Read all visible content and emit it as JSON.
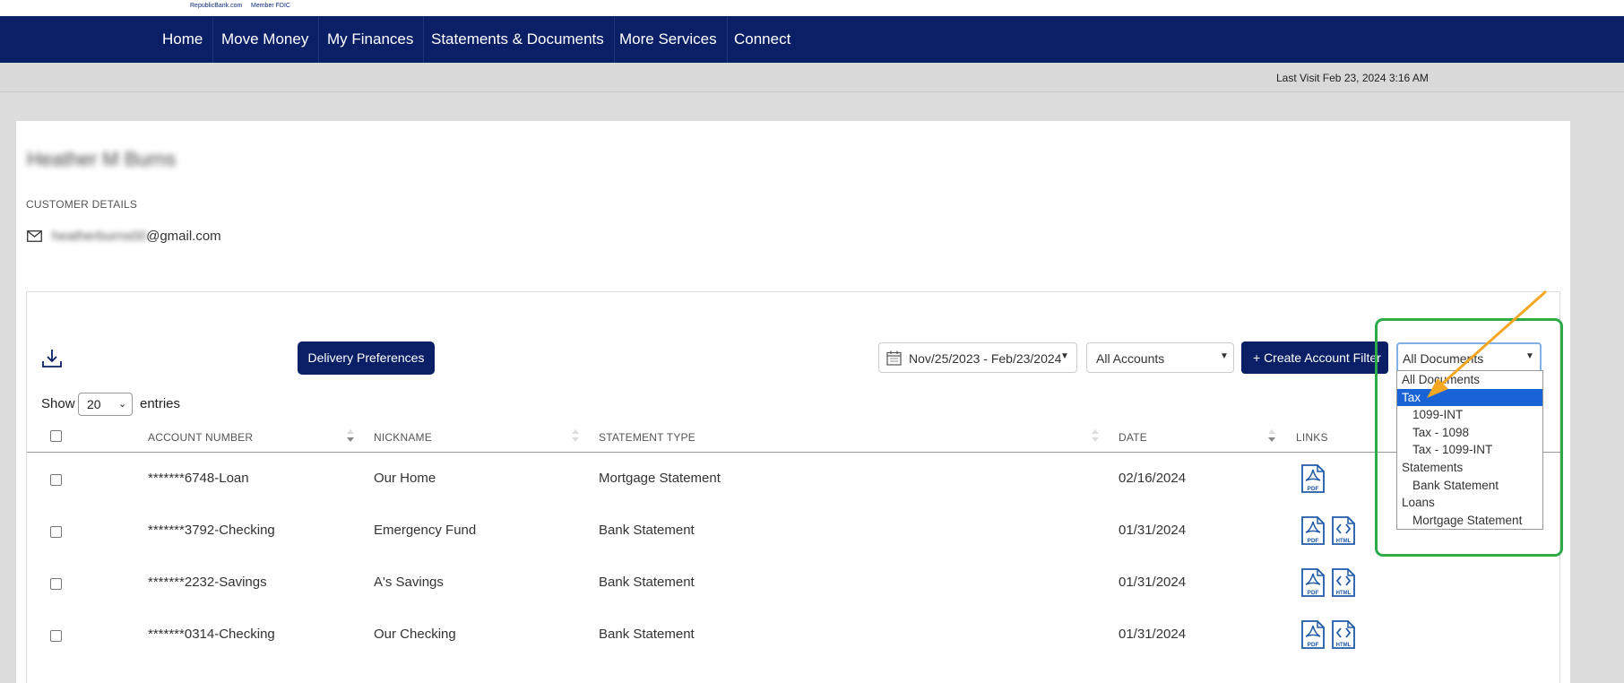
{
  "header": {
    "top_links": [
      "RepublicBank.com",
      "Member FDIC"
    ],
    "nav": [
      "Home",
      "Move Money",
      "My Finances",
      "Statements & Documents",
      "More Services",
      "Connect"
    ],
    "last_visit": "Last Visit Feb 23, 2024 3:16 AM"
  },
  "customer": {
    "name": "Heather M Burns",
    "details_label": "CUSTOMER DETAILS",
    "email_user": "heatherburns00",
    "email_domain": "@gmail.com"
  },
  "toolbar": {
    "delivery_label": "Delivery Preferences",
    "date_range": "Nov/25/2023 - Feb/23/2024",
    "accounts_value": "All Accounts",
    "create_filter_label": "+ Create Account Filter",
    "documents_value": "All Documents"
  },
  "documents_dropdown": [
    {
      "label": "All Documents",
      "level": 0,
      "selected": false
    },
    {
      "label": "Tax",
      "level": 0,
      "selected": true
    },
    {
      "label": "1099-INT",
      "level": 1,
      "selected": false
    },
    {
      "label": "Tax - 1098",
      "level": 1,
      "selected": false
    },
    {
      "label": "Tax - 1099-INT",
      "level": 1,
      "selected": false
    },
    {
      "label": "Statements",
      "level": 0,
      "selected": false
    },
    {
      "label": "Bank Statement",
      "level": 1,
      "selected": false
    },
    {
      "label": "Loans",
      "level": 0,
      "selected": false
    },
    {
      "label": "Mortgage Statement",
      "level": 1,
      "selected": false
    }
  ],
  "entries": {
    "show_label": "Show",
    "value": "20",
    "suffix": "entries"
  },
  "table": {
    "columns": [
      "ACCOUNT NUMBER",
      "NICKNAME",
      "STATEMENT TYPE",
      "DATE",
      "LINKS"
    ],
    "rows": [
      {
        "account": "*******6748-Loan",
        "nickname": "Our Home",
        "type": "Mortgage Statement",
        "date": "02/16/2024",
        "links": [
          "PDF"
        ]
      },
      {
        "account": "*******3792-Checking",
        "nickname": "Emergency Fund",
        "type": "Bank Statement",
        "date": "01/31/2024",
        "links": [
          "PDF",
          "HTML"
        ]
      },
      {
        "account": "*******2232-Savings",
        "nickname": "A's Savings",
        "type": "Bank Statement",
        "date": "01/31/2024",
        "links": [
          "PDF",
          "HTML"
        ]
      },
      {
        "account": "*******0314-Checking",
        "nickname": "Our Checking",
        "type": "Bank Statement",
        "date": "01/31/2024",
        "links": [
          "PDF",
          "HTML"
        ]
      }
    ]
  },
  "colors": {
    "nav_bg": "#0b1f66",
    "highlight": "#1a63d6",
    "annotation_box": "#2eaa4a",
    "annotation_arrow": "#f5a623",
    "icon_blue": "#1e5aa8"
  }
}
